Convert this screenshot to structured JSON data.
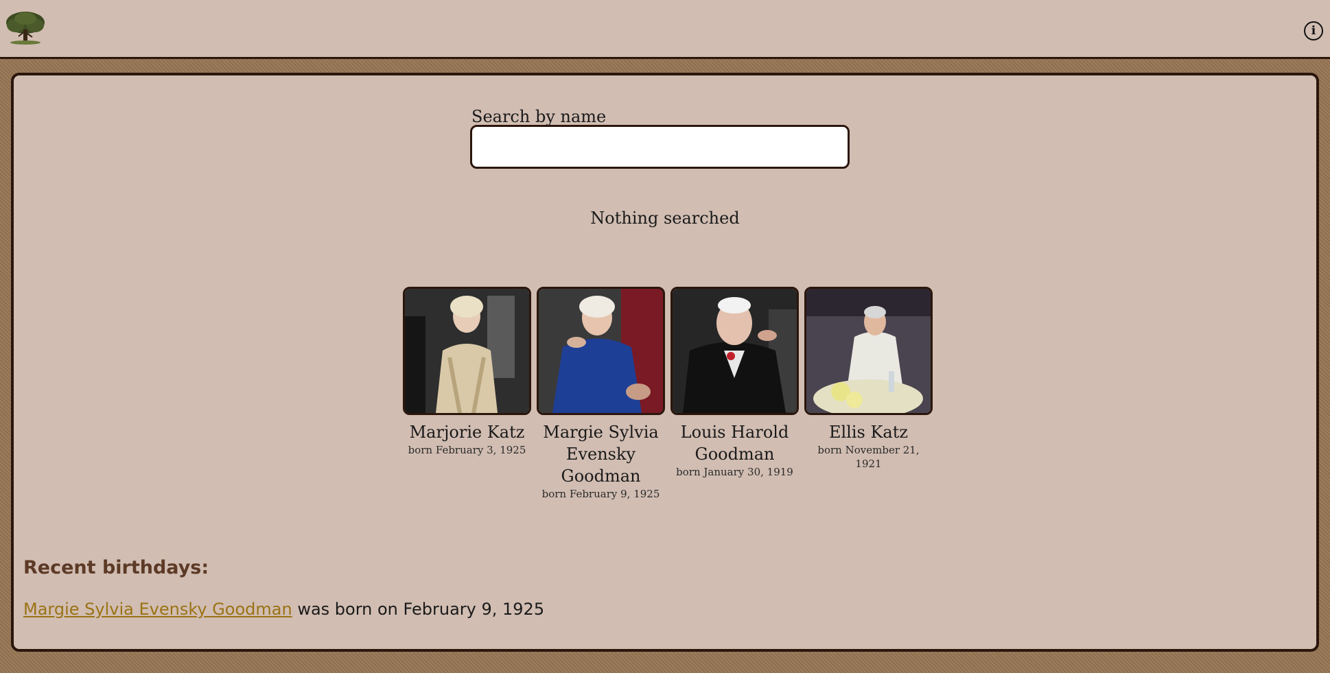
{
  "header": {
    "logo_icon": "tree-icon",
    "info_icon": "info-icon",
    "info_glyph": "i"
  },
  "search": {
    "label": "Search by name",
    "value": "",
    "placeholder": ""
  },
  "status": "Nothing searched",
  "people": [
    {
      "name": "Marjorie Katz",
      "born": "born February 3, 1925"
    },
    {
      "name": "Margie Sylvia Evensky Goodman",
      "born": "born February 9, 1925"
    },
    {
      "name": "Louis Harold Goodman",
      "born": "born January 30, 1919"
    },
    {
      "name": "Ellis Katz",
      "born": "born November 21, 1921"
    }
  ],
  "recent": {
    "title": "Recent birthdays:",
    "link": "Margie Sylvia Evensky Goodman",
    "text": " was born on February 9, 1925"
  },
  "colors": {
    "panel": "#d1bdb2",
    "border": "#2b160c",
    "heading": "#5c3a26",
    "link": "#9a7314"
  }
}
